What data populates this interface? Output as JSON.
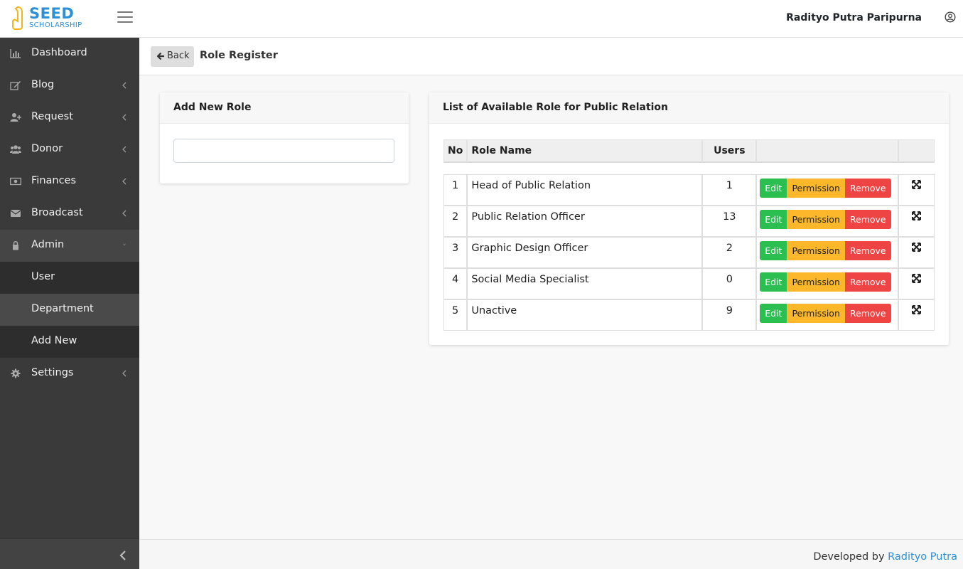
{
  "app": {
    "logo_line1": "SEED",
    "logo_line2": "SCHOLARSHIP",
    "user_name": "Radityo Putra Paripurna"
  },
  "sidebar": {
    "items": [
      {
        "label": "Dashboard",
        "icon": "bar-chart-icon"
      },
      {
        "label": "Blog",
        "icon": "edit-icon"
      },
      {
        "label": "Request",
        "icon": "user-plus-icon"
      },
      {
        "label": "Donor",
        "icon": "users-icon"
      },
      {
        "label": "Finances",
        "icon": "money-icon"
      },
      {
        "label": "Broadcast",
        "icon": "envelope-icon"
      },
      {
        "label": "Admin",
        "icon": "lock-icon"
      },
      {
        "label": "Settings",
        "icon": "gear-icon"
      }
    ],
    "admin_sub": [
      "User",
      "Department",
      "Add New"
    ],
    "selected_sub": "Department"
  },
  "subheader": {
    "back_label": "Back",
    "title": "Role Register"
  },
  "add_card": {
    "title": "Add New Role",
    "input_value": ""
  },
  "list_card": {
    "title": "List of Available Role for Public Relation",
    "columns": [
      "No",
      "Role Name",
      "Users",
      "",
      ""
    ],
    "rows": [
      {
        "no": "1",
        "name": "Head of Public Relation",
        "users": "1"
      },
      {
        "no": "2",
        "name": "Public Relation Officer",
        "users": "13"
      },
      {
        "no": "3",
        "name": "Graphic Design Officer",
        "users": "2"
      },
      {
        "no": "4",
        "name": "Social Media Specialist",
        "users": "0"
      },
      {
        "no": "5",
        "name": "Unactive",
        "users": "9"
      }
    ],
    "actions": {
      "edit": "Edit",
      "permission": "Permission",
      "remove": "Remove"
    }
  },
  "footer": {
    "prefix": "Developed by",
    "author": "Radityo Putra"
  },
  "colors": {
    "sidebar_bg": "#3a3a3a",
    "edit_green": "#2bbf51",
    "permission_yellow": "#fcb82a",
    "remove_red": "#ef4444",
    "link_blue": "#2d8fd6"
  }
}
